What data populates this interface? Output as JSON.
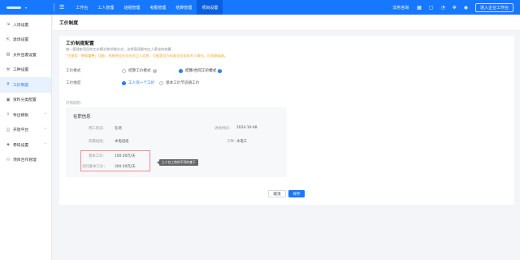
{
  "topbar": {
    "logo_text": "",
    "nav": [
      "工作台",
      "工人管理",
      "班组管理",
      "考勤管理",
      "结算管理",
      "项目设置"
    ],
    "active_nav": "项目设置",
    "service_text": "法务咨询",
    "enter_button": "进入企业工作台",
    "icons": [
      "qrcode-icon",
      "chat-icon",
      "bell-icon",
      "gear-icon",
      "user-icon"
    ]
  },
  "sidebar": {
    "items": [
      {
        "label": "入场设置",
        "icon": "login-icon",
        "arrow": ""
      },
      {
        "label": "退场设置",
        "icon": "logout-icon",
        "arrow": ""
      },
      {
        "label": "文件签署设置",
        "icon": "file-icon",
        "arrow": ""
      },
      {
        "label": "工种设置",
        "icon": "tool-icon",
        "arrow": ""
      },
      {
        "label": "工价制度",
        "icon": "money-icon",
        "arrow": "",
        "active": true
      },
      {
        "label": "资料分类配置",
        "icon": "folder-icon",
        "arrow": ""
      },
      {
        "label": "导出模板",
        "icon": "export-icon",
        "arrow": "﹀"
      },
      {
        "label": "开放平台",
        "icon": "platform-icon",
        "arrow": "﹀"
      },
      {
        "label": "券码设置",
        "icon": "ticket-icon",
        "arrow": "﹀"
      },
      {
        "label": "项目合作管理",
        "icon": "handshake-icon",
        "arrow": ""
      }
    ]
  },
  "page": {
    "breadcrumb": "工价制度"
  },
  "config": {
    "title": "工价制度配置",
    "desc": "统一管理本项目的工价模式和领域方式，这将直接影响工人薪金的结算",
    "warning": "*注意用「更换重整」功能，系统将会在对应的工人信息，可能是对方标准化优化和专人操作。可选基础调。",
    "mode_label": "工价模式",
    "mode_options": [
      "结算工价模式",
      "结算/合同工价模式"
    ],
    "mode_selected": 1,
    "dimension_label": "工价维度",
    "dimension_options": [
      "工人仅一个工价",
      "基本工价节追随工价"
    ],
    "dimension_selected": 0,
    "example_label": "示例说明："
  },
  "preview": {
    "title": "在职信息",
    "status_label": "用工状态：",
    "status_value": "在场",
    "entry_label": "进场时间：",
    "entry_value": "2024-10-08",
    "team_label": "所属班组：",
    "team_value": "木电班组",
    "trade_label": "工种：",
    "trade_value": "水电工",
    "base_label": "基本工价：",
    "base_value": "100.00元/天",
    "contract_label": "合同基本工价：",
    "contract_value": "300.00元/天",
    "tooltip": "工人在工地的不同的基于"
  },
  "actions": {
    "cancel": "取消",
    "save": "保存"
  },
  "colors": {
    "primary": "#1677ff",
    "warning": "#f5a623",
    "highlight_border": "#f08c8c"
  }
}
